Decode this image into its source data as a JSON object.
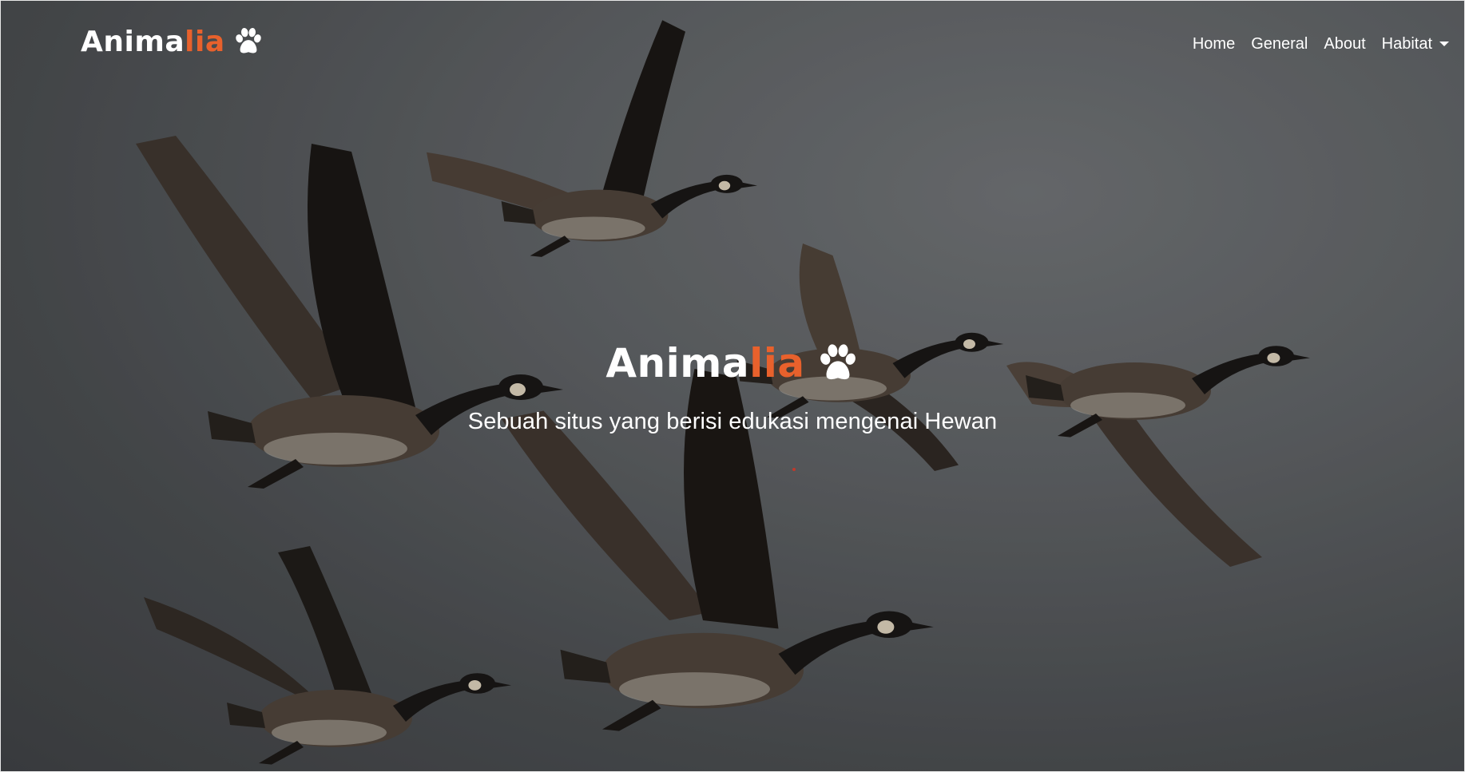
{
  "brand": {
    "name_main": "Anima",
    "name_accent": "lia",
    "icon": "paw-icon"
  },
  "nav": {
    "items": [
      {
        "label": "Home"
      },
      {
        "label": "General"
      },
      {
        "label": "About"
      },
      {
        "label": "Habitat",
        "dropdown": true
      }
    ]
  },
  "hero": {
    "title_main": "Anima",
    "title_accent": "lia",
    "icon": "paw-icon",
    "tagline": "Sebuah situs yang berisi edukasi mengenai Hewan"
  },
  "colors": {
    "accent": "#e8612c",
    "text": "#ffffff",
    "background": "#55585b"
  }
}
